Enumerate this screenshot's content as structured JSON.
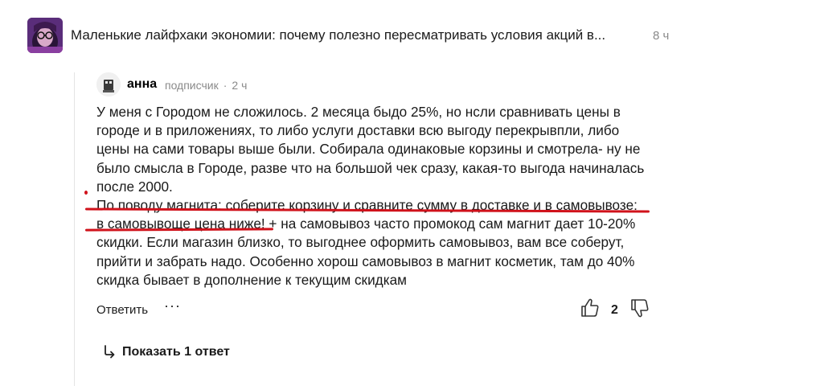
{
  "header": {
    "title": "Маленькие лайфхаки экономии: почему полезно пересматривать условия акций в...",
    "time": "8 ч"
  },
  "comment": {
    "author": "анна",
    "role": "подписчик",
    "separator": "·",
    "time": "2 ч",
    "lines": [
      "У меня с Городом не сложилось. 2 месяца быдо 25%, но нсли сравнивать цены в",
      "городе и в приложениях, то либо услуги доставки всю выгоду перекрывпли, либо",
      "цены на сами товары выше были. Собирала одинаковые корзины и смотрела- ну не",
      "было смысла в Городе, разве что на большой чек сразу, какая-то выгода начиналась",
      "после 2000.",
      "По поводу магнита: соберите корзину и сравните сумму в доставке и в самовывозе:",
      "в самовывоще цена ниже! + на самовывоз часто промокод сам магнит дает 10-20%",
      "скидки. Если магазин близко, то выгоднее оформить самовывоз, вам все соберут,",
      "прийти и забрать надо. Особенно хорош самовывоз в магнит косметик, там до 40%",
      "скидка бывает в дополнение к текущим скидкам"
    ],
    "reply_label": "Ответить",
    "more_label": "···",
    "like_count": "2",
    "show_replies_label": "Показать 1 ответ"
  },
  "icons": {
    "avatar_header": "user-avatar-icon",
    "avatar_comment": "user-avatar-icon",
    "like": "thumbs-up-icon",
    "dislike": "thumbs-down-icon",
    "replies": "reply-arrow-icon"
  },
  "colors": {
    "annotation": "#d0121b",
    "muted_text": "#8a8a8a"
  }
}
